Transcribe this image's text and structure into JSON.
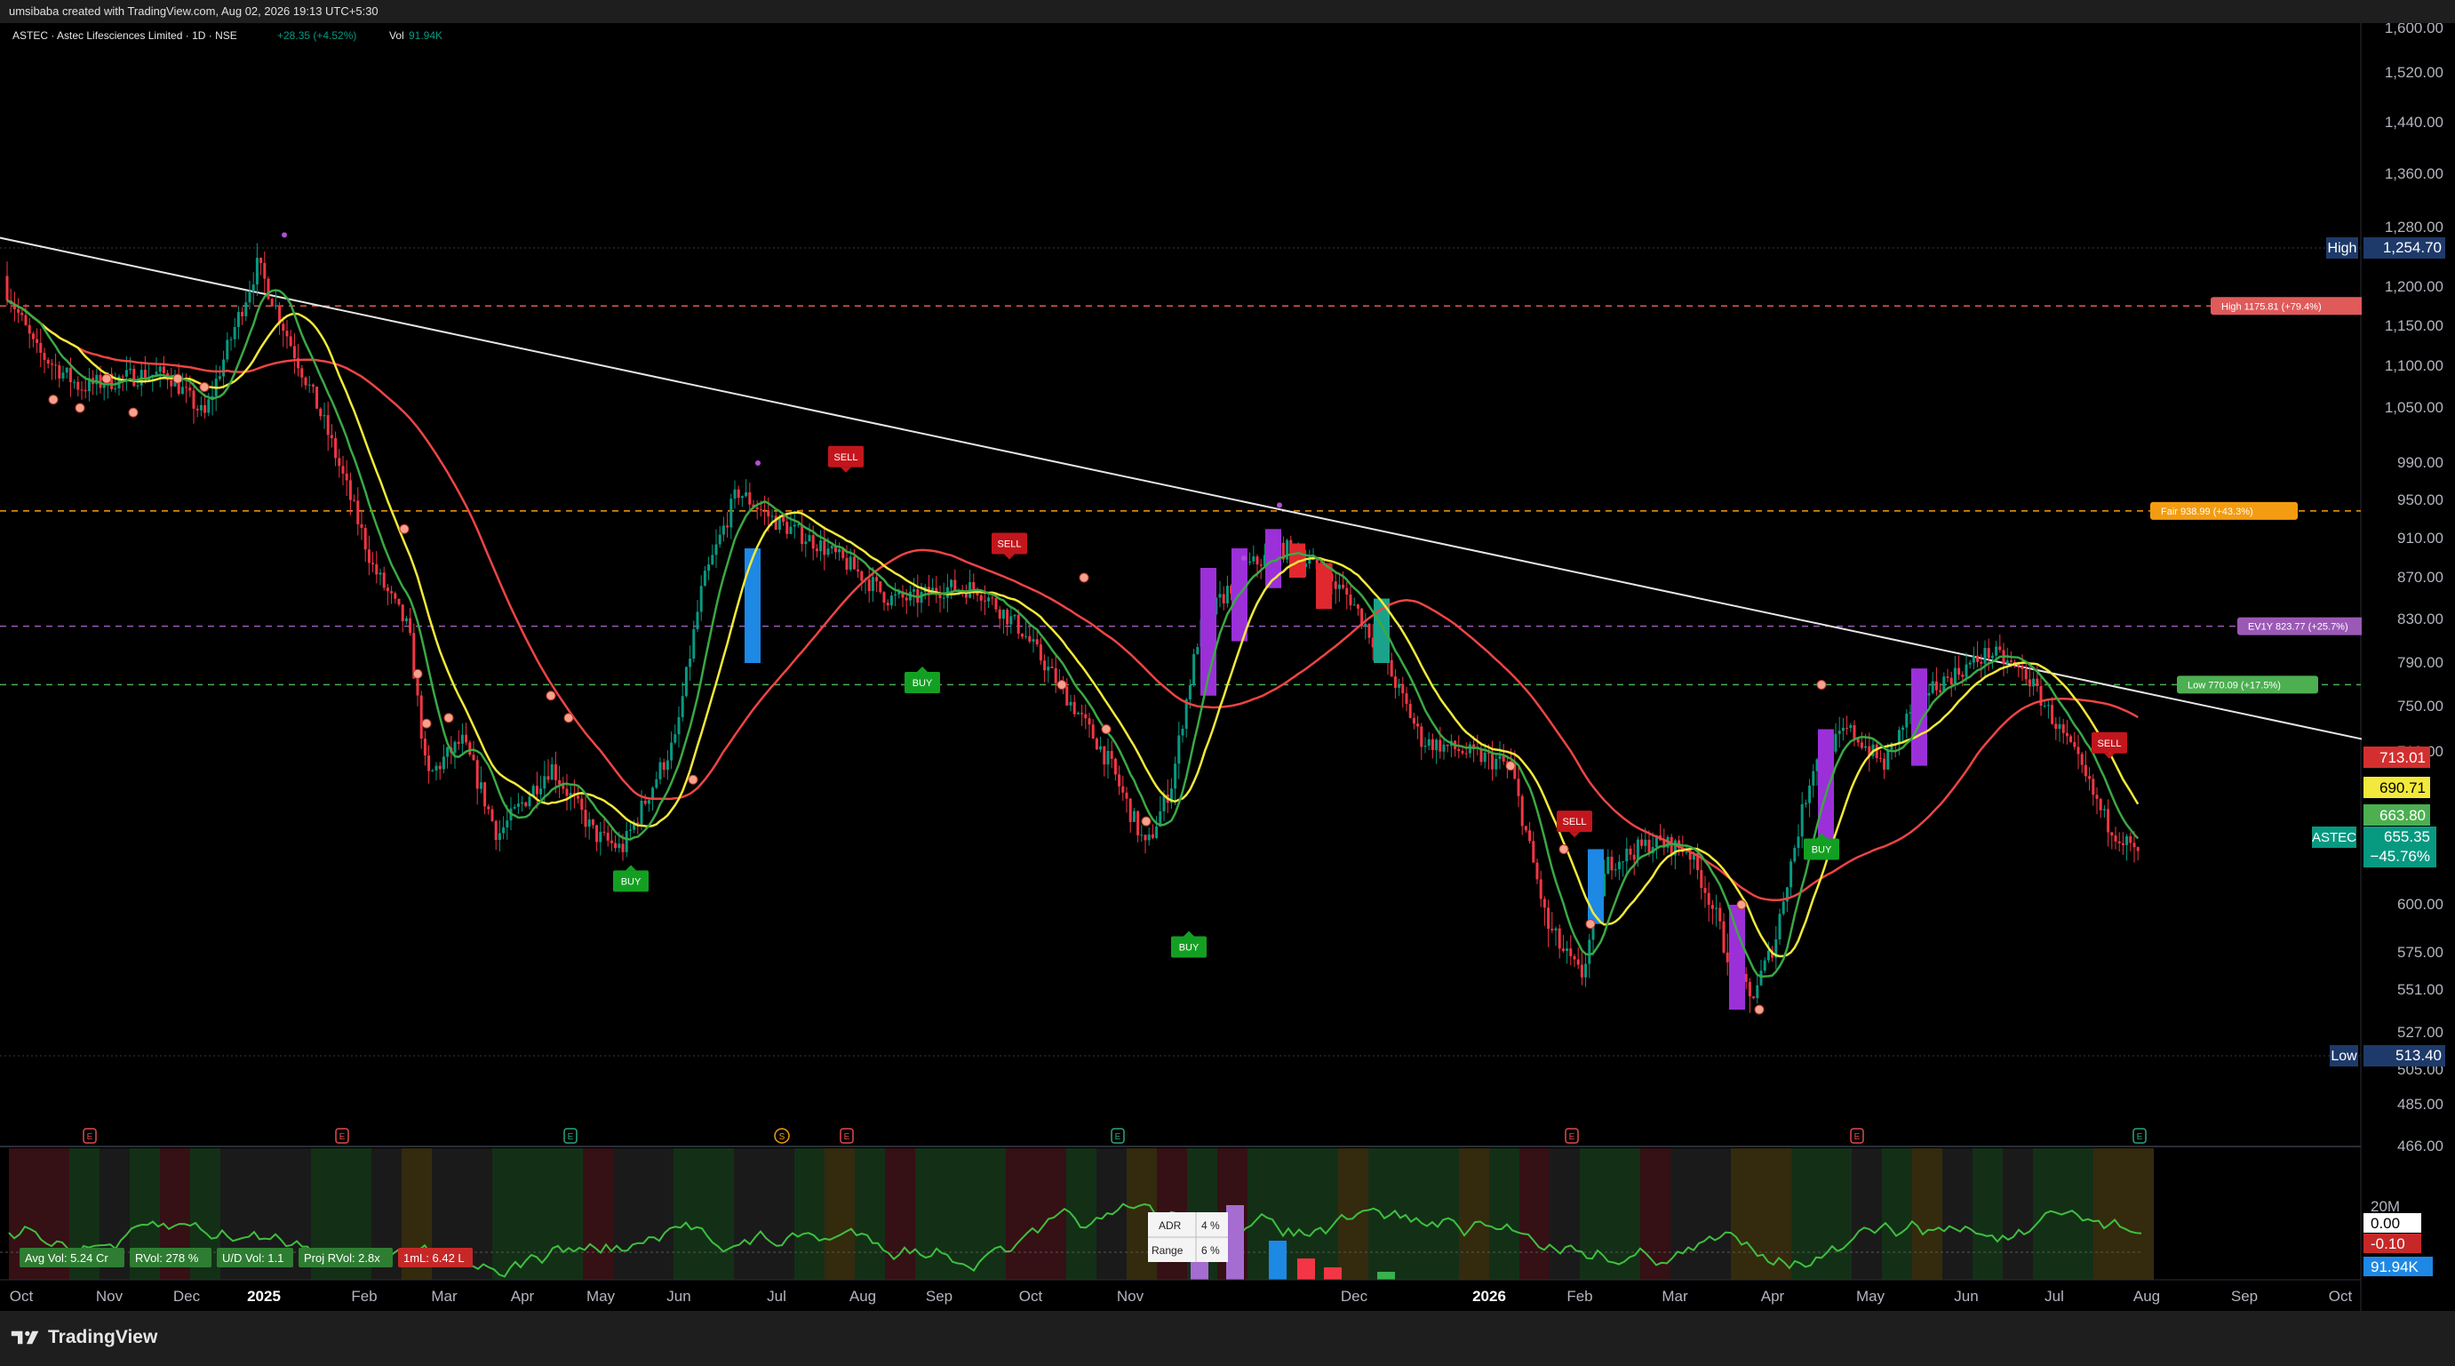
{
  "header": {
    "attribution": "umsibaba created with TradingView.com, Aug 02, 2026 19:13 UTC+5:30"
  },
  "legend": {
    "symbol": "ASTEC · Astec Lifesciences Limited · 1D · NSE",
    "change": "+28.35 (+4.52%)",
    "vol_label": "Vol",
    "vol_value": "91.94K"
  },
  "brand": {
    "name": "TradingView"
  },
  "chart_data": {
    "type": "candlestick",
    "price_axis": {
      "ticks": [
        "1,600.00",
        "1,520.00",
        "1,440.00",
        "1,360.00",
        "1,280.00",
        "1,200.00",
        "1,150.00",
        "1,100.00",
        "1,050.00",
        "990.00",
        "950.00",
        "910.00",
        "870.00",
        "830.00",
        "790.00",
        "750.00",
        "710.00",
        "600.00",
        "575.00",
        "551.00",
        "527.00",
        "505.00",
        "485.00",
        "466.00"
      ]
    },
    "time_axis": {
      "labels": [
        "Oct",
        "Nov",
        "Dec",
        "2025",
        "Feb",
        "Mar",
        "Apr",
        "May",
        "Jun",
        "Jul",
        "Aug",
        "Sep",
        "Oct",
        "Nov",
        "Dec",
        "2026",
        "Feb",
        "Mar",
        "Apr",
        "May",
        "Jun",
        "Jul",
        "Aug",
        "Sep",
        "Oct"
      ],
      "bold": [
        "2025",
        "2026"
      ]
    },
    "markers": {
      "high": {
        "label": "High",
        "value": "1,254.70"
      },
      "low": {
        "label": "Low",
        "value": "513.40"
      }
    },
    "levels": [
      {
        "label": "High 1175.81 (+79.4%)",
        "value": 1175.81,
        "color": "#e05a5a"
      },
      {
        "label": "Fair 938.99 (+43.3%)",
        "value": 938.99,
        "color": "#f39c12"
      },
      {
        "label": "EV1Y 823.77 (+25.7%)",
        "value": 823.77,
        "color": "#9b59b6"
      },
      {
        "label": "Low 770.09 (+17.5%)",
        "value": 770.09,
        "color": "#4caf50"
      }
    ],
    "price_labels": [
      {
        "value": "713.01",
        "color": "#d32f2f"
      },
      {
        "value": "690.71",
        "color": "#f2e93a"
      },
      {
        "value": "663.80",
        "color": "#4caf50"
      },
      {
        "symbol": "ASTEC",
        "value": "655.35",
        "change": "−45.76%",
        "color": "#089981"
      }
    ],
    "signals": [
      {
        "type": "SELL",
        "date": "2025-07-28"
      },
      {
        "type": "SELL",
        "date": "2025-09-12"
      },
      {
        "type": "SELL",
        "date": "2026-01-28"
      },
      {
        "type": "SELL",
        "date": "2026-07-08"
      },
      {
        "type": "BUY",
        "date": "2025-05-10"
      },
      {
        "type": "BUY",
        "date": "2025-08-22"
      },
      {
        "type": "BUY",
        "date": "2025-11-01"
      },
      {
        "type": "BUY",
        "date": "2026-04-28"
      }
    ],
    "moving_averages": [
      {
        "color": "#ef4444"
      },
      {
        "color": "#f2e93a"
      },
      {
        "color": "#3aa845"
      }
    ],
    "trendline": {
      "from": {
        "date": "2024-09-25",
        "price": 1268
      },
      "to": {
        "date": "2026-10-15",
        "price": 719
      }
    },
    "events": [
      "E",
      "E",
      "E",
      "S",
      "E",
      "E",
      "E",
      "E",
      "E"
    ],
    "indicator": {
      "axis": [
        "20M",
        "0.00",
        "-0.10",
        "91.94K"
      ],
      "stats": [
        "Avg Vol: 5.24 Cr",
        "RVol: 278 %",
        "U/D Vol: 1.1",
        "Proj RVol: 2.8x",
        "1mL: 6.42 L"
      ],
      "adr_label": "ADR",
      "adr_value": "4 %",
      "range_label": "Range",
      "range_value": "6 %"
    }
  }
}
